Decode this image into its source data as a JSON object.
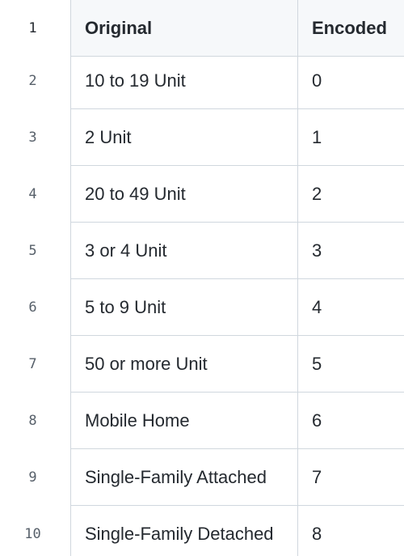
{
  "table": {
    "header": {
      "line_number": "1",
      "col_original": "Original",
      "col_encoded": "Encoded"
    },
    "rows": [
      {
        "line_number": "2",
        "original": "10 to 19 Unit",
        "encoded": "0"
      },
      {
        "line_number": "3",
        "original": "2 Unit",
        "encoded": "1"
      },
      {
        "line_number": "4",
        "original": "20 to 49 Unit",
        "encoded": "2"
      },
      {
        "line_number": "5",
        "original": "3 or 4 Unit",
        "encoded": "3"
      },
      {
        "line_number": "6",
        "original": "5 to 9 Unit",
        "encoded": "4"
      },
      {
        "line_number": "7",
        "original": "50 or more Unit",
        "encoded": "5"
      },
      {
        "line_number": "8",
        "original": "Mobile Home",
        "encoded": "6"
      },
      {
        "line_number": "9",
        "original": "Single-Family Attached",
        "encoded": "7"
      },
      {
        "line_number": "10",
        "original": "Single-Family Detached",
        "encoded": "8"
      }
    ]
  },
  "colors": {
    "header_bg": "#f6f8fa",
    "border": "#d0d7de",
    "text": "#24292f",
    "line_number_text": "#57606a"
  }
}
